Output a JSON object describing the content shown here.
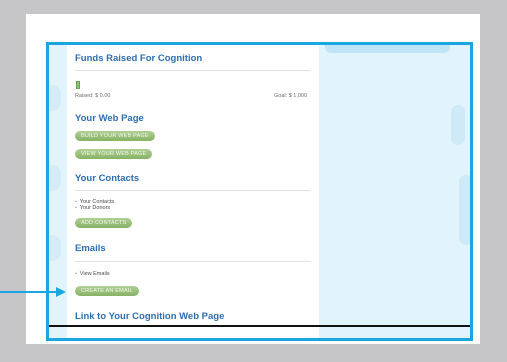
{
  "funds": {
    "title": "Funds Raised For Cognition",
    "raised_label": "Raised: $ 0.00",
    "goal_label": "Goal: $ 1,000"
  },
  "webpage": {
    "title": "Your Web Page",
    "build_button": "BUILD YOUR WEB PAGE",
    "view_button": "VIEW YOUR WEB PAGE"
  },
  "contacts": {
    "title": "Your Contacts",
    "links": [
      "Your Contacts",
      "Your Donors"
    ],
    "add_button": "ADD CONTACTS"
  },
  "emails": {
    "title": "Emails",
    "view_link": "View Emails",
    "create_button": "CREATE AN EMAIL"
  },
  "link_section": {
    "title": "Link to Your Cognition Web Page"
  },
  "colors": {
    "highlight": "#1aa6e0",
    "heading": "#2d6db0",
    "button": "#8db96b"
  }
}
